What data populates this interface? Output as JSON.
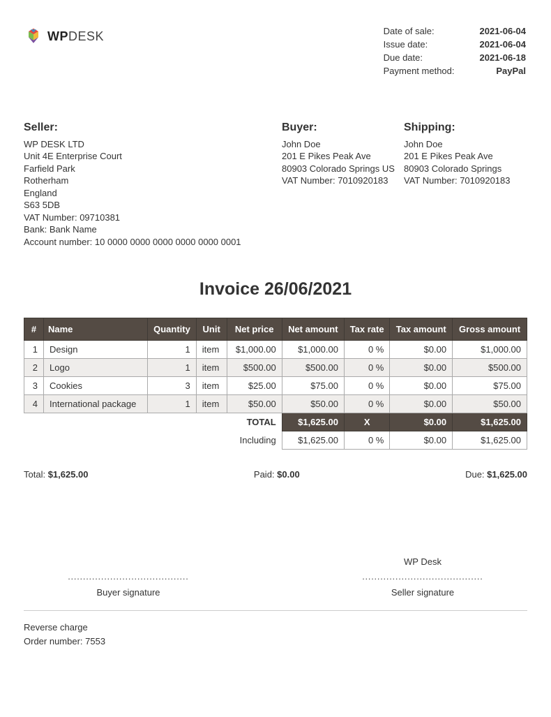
{
  "logo": {
    "bold": "WP",
    "light": "DESK"
  },
  "meta": {
    "date_of_sale_label": "Date of sale:",
    "date_of_sale": "2021-06-04",
    "issue_date_label": "Issue date:",
    "issue_date": "2021-06-04",
    "due_date_label": "Due date:",
    "due_date": "2021-06-18",
    "payment_method_label": "Payment method:",
    "payment_method": "PayPal"
  },
  "seller": {
    "heading": "Seller:",
    "l1": "WP DESK LTD",
    "l2": "Unit 4E Enterprise Court",
    "l3": "Farfield Park",
    "l4": "Rotherham",
    "l5": "England",
    "l6": "S63 5DB",
    "l7": "VAT Number: 09710381",
    "l8": "Bank: Bank Name",
    "l9": "Account number: 10 0000 0000 0000 0000 0000 0001"
  },
  "buyer": {
    "heading": "Buyer:",
    "l1": "John Doe",
    "l2": "201 E Pikes Peak Ave",
    "l3": "80903 Colorado Springs US",
    "l4": "VAT Number: 7010920183"
  },
  "shipping": {
    "heading": "Shipping:",
    "l1": "John Doe",
    "l2": "201 E Pikes Peak Ave",
    "l3": "80903 Colorado Springs",
    "l4": "VAT Number: 7010920183"
  },
  "title": "Invoice 26/06/2021",
  "cols": {
    "idx": "#",
    "name": "Name",
    "qty": "Quantity",
    "unit": "Unit",
    "net_price": "Net price",
    "net_amount": "Net amount",
    "tax_rate": "Tax rate",
    "tax_amount": "Tax amount",
    "gross": "Gross amount"
  },
  "rows": [
    {
      "idx": "1",
      "name": "Design",
      "qty": "1",
      "unit": "item",
      "net_price": "$1,000.00",
      "net_amount": "$1,000.00",
      "tax_rate": "0 %",
      "tax_amount": "$0.00",
      "gross": "$1,000.00"
    },
    {
      "idx": "2",
      "name": "Logo",
      "qty": "1",
      "unit": "item",
      "net_price": "$500.00",
      "net_amount": "$500.00",
      "tax_rate": "0 %",
      "tax_amount": "$0.00",
      "gross": "$500.00"
    },
    {
      "idx": "3",
      "name": "Cookies",
      "qty": "3",
      "unit": "item",
      "net_price": "$25.00",
      "net_amount": "$75.00",
      "tax_rate": "0 %",
      "tax_amount": "$0.00",
      "gross": "$75.00"
    },
    {
      "idx": "4",
      "name": "International package",
      "qty": "1",
      "unit": "item",
      "net_price": "$50.00",
      "net_amount": "$50.00",
      "tax_rate": "0 %",
      "tax_amount": "$0.00",
      "gross": "$50.00"
    }
  ],
  "total": {
    "label": "TOTAL",
    "net_amount": "$1,625.00",
    "tax_rate": "X",
    "tax_amount": "$0.00",
    "gross": "$1,625.00"
  },
  "including": {
    "label": "Including",
    "net_amount": "$1,625.00",
    "tax_rate": "0 %",
    "tax_amount": "$0.00",
    "gross": "$1,625.00"
  },
  "summary": {
    "total_label": "Total: ",
    "total_val": "$1,625.00",
    "paid_label": "Paid: ",
    "paid_val": "$0.00",
    "due_label": "Due: ",
    "due_val": "$1,625.00"
  },
  "signatures": {
    "seller_name": "WP Desk",
    "buyer_label": "Buyer signature",
    "seller_label": "Seller signature"
  },
  "footer": {
    "l1": "Reverse charge",
    "l2": "Order number: 7553"
  }
}
